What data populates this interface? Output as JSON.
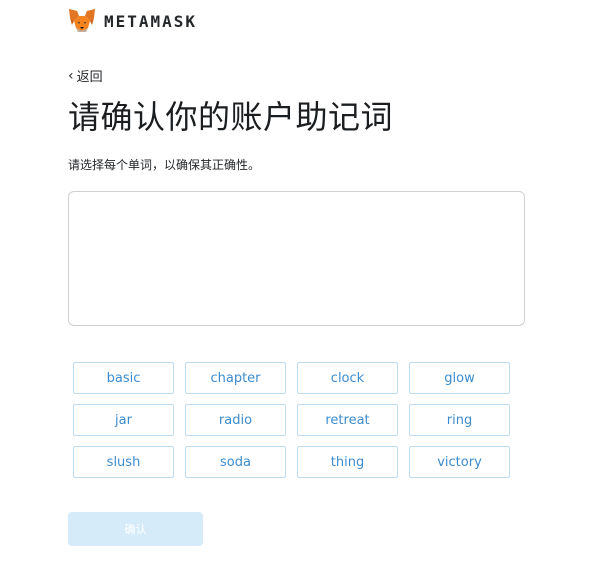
{
  "brand": {
    "name": "METAMASK",
    "logo_icon": "fox-icon"
  },
  "nav": {
    "back_label": "返回",
    "back_icon": "chevron-left-icon"
  },
  "heading": {
    "title": "请确认你的账户助记词",
    "subtitle": "请选择每个单词，以确保其正确性。"
  },
  "words": [
    "basic",
    "chapter",
    "clock",
    "glow",
    "jar",
    "radio",
    "retreat",
    "ring",
    "slush",
    "soda",
    "thing",
    "victory"
  ],
  "actions": {
    "confirm_label": "确认"
  },
  "colors": {
    "accent": "#3c8ccf",
    "word_border": "#bfdcf0",
    "confirm_disabled_bg": "#d6ebfa",
    "fox_orange": "#e2761b"
  }
}
